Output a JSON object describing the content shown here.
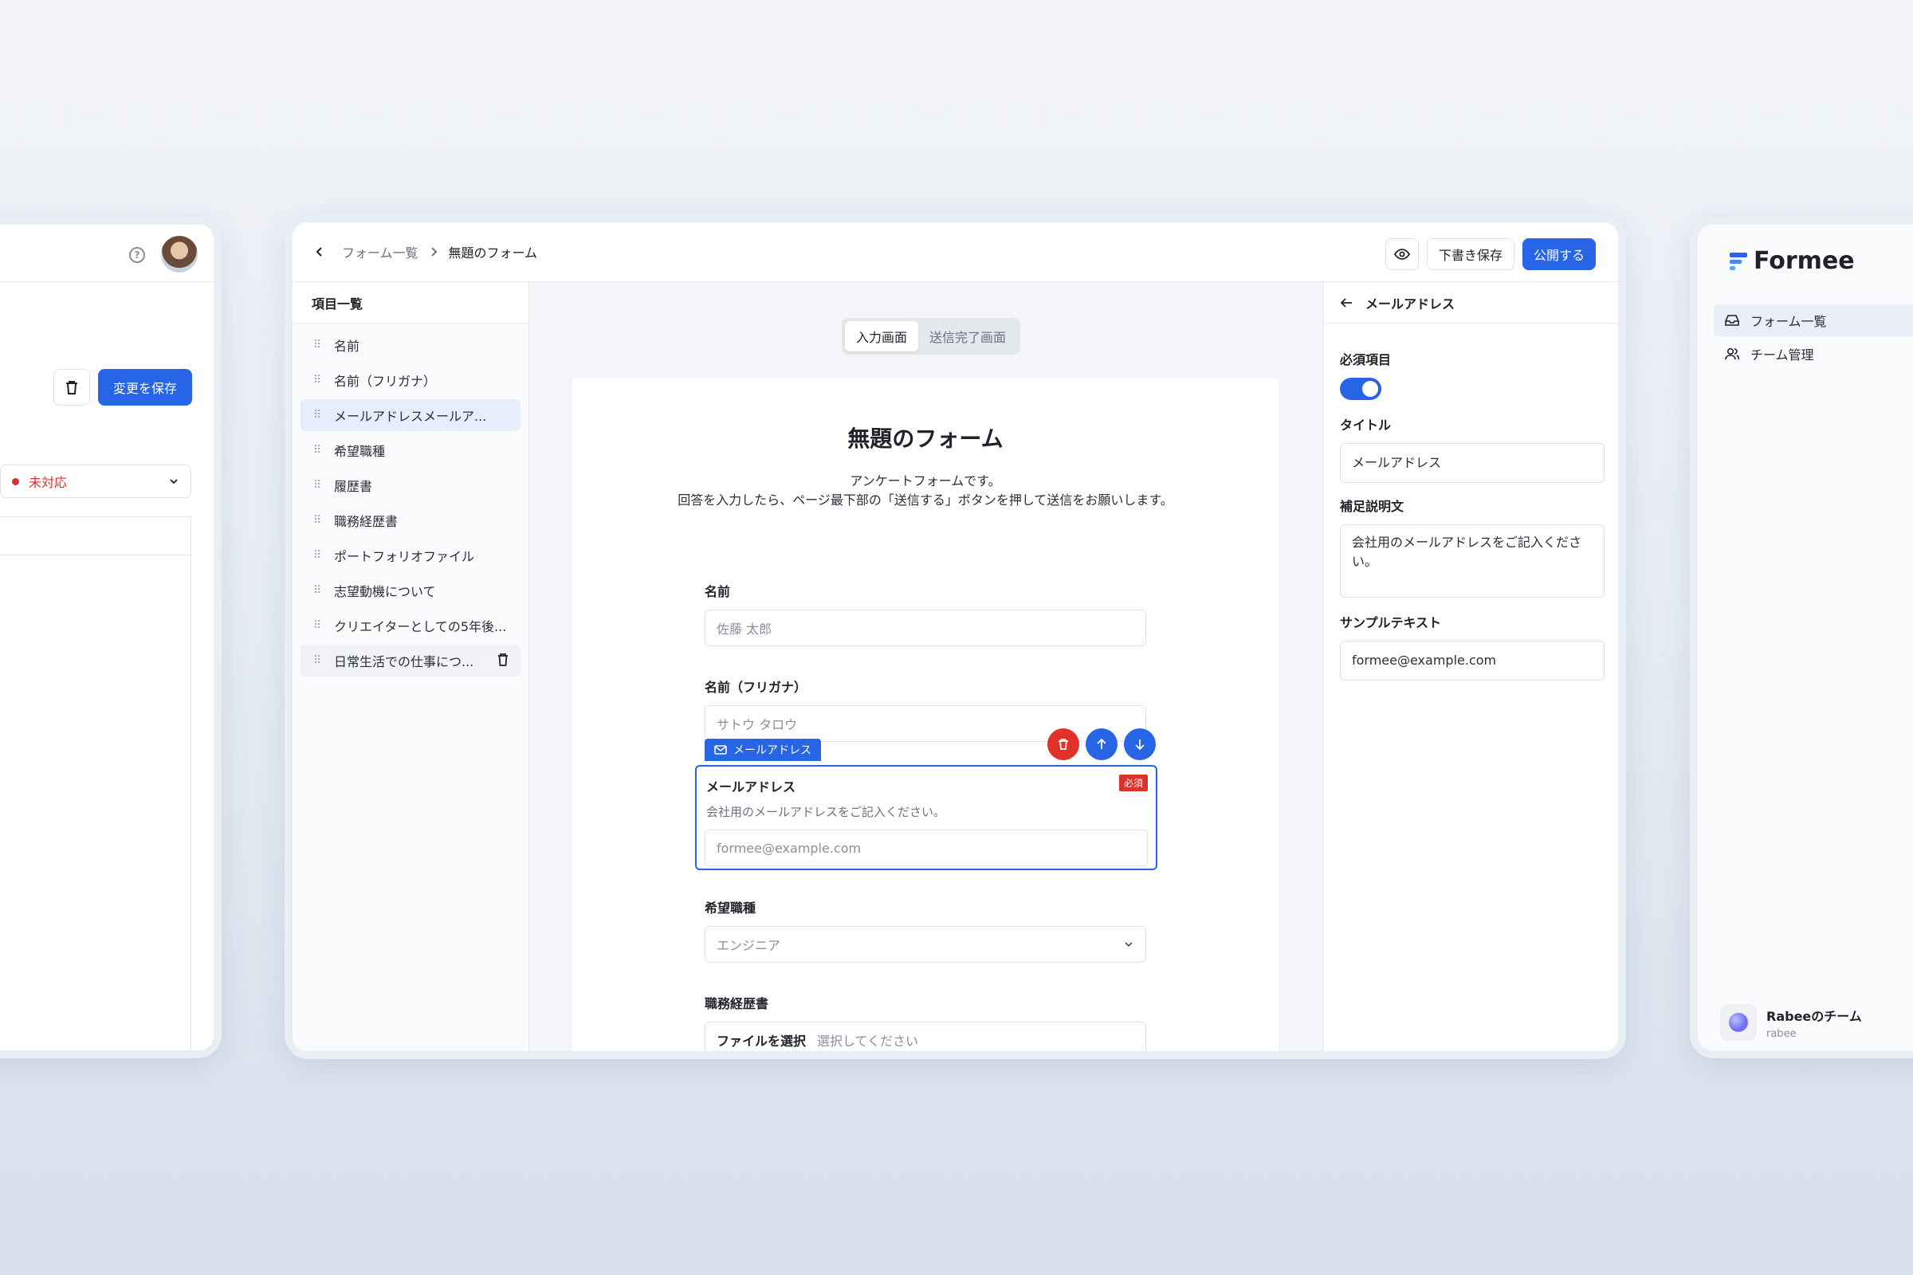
{
  "left_frame": {
    "save_button": "変更を保存",
    "status_select": "未対応"
  },
  "main": {
    "breadcrumb": {
      "parent": "フォーム一覧",
      "current": "無題のフォーム"
    },
    "actions": {
      "draft": "下書き保存",
      "publish": "公開する"
    },
    "list": {
      "header": "項目一覧",
      "items": [
        {
          "label": "名前"
        },
        {
          "label": "名前（フリガナ）"
        },
        {
          "label": "メールアドレスメールア..."
        },
        {
          "label": "希望職種"
        },
        {
          "label": "履歴書"
        },
        {
          "label": "職務経歴書"
        },
        {
          "label": "ポートフォリオファイル"
        },
        {
          "label": "志望動機について"
        },
        {
          "label": "クリエイターとしての5年後..."
        },
        {
          "label": "日常生活での仕事につ..."
        }
      ]
    },
    "tabs": [
      {
        "label": "入力画面"
      },
      {
        "label": "送信完了画面"
      }
    ],
    "form": {
      "title": "無題のフォーム",
      "description_line1": "アンケートフォームです。",
      "description_line2": "回答を入力したら、ページ最下部の「送信する」ボタンを押して送信をお願いします。",
      "fields": {
        "name": {
          "label": "名前",
          "placeholder": "佐藤 太郎"
        },
        "kana": {
          "label": "名前（フリガナ）",
          "placeholder": "サトウ タロウ"
        },
        "email": {
          "type_tag": "メールアドレス",
          "label": "メールアドレス",
          "required_badge": "必須",
          "help": "会社用のメールアドレスをご記入ください。",
          "placeholder": "formee@example.com"
        },
        "job": {
          "label": "希望職種",
          "value": "エンジニア"
        },
        "career": {
          "label": "職務経歴書",
          "button": "ファイルを選択",
          "placeholder": "選択してください"
        }
      }
    },
    "properties": {
      "header": "メールアドレス",
      "required_label": "必須項目",
      "required_on": true,
      "title_label": "タイトル",
      "title_value": "メールアドレス",
      "help_label": "補足説明文",
      "help_value": "会社用のメールアドレスをご記入ください。",
      "sample_label": "サンプルテキスト",
      "sample_value": "formee@example.com"
    }
  },
  "right_frame": {
    "brand": "Formee",
    "nav": [
      {
        "label": "フォーム一覧",
        "icon": "inbox-icon"
      },
      {
        "label": "チーム管理",
        "icon": "users-icon"
      }
    ],
    "team": {
      "name": "Rabeeのチーム",
      "slug": "rabee"
    }
  },
  "colors": {
    "accent": "#2764e6",
    "danger": "#d9342b",
    "active_bg": "#e6edfb"
  }
}
